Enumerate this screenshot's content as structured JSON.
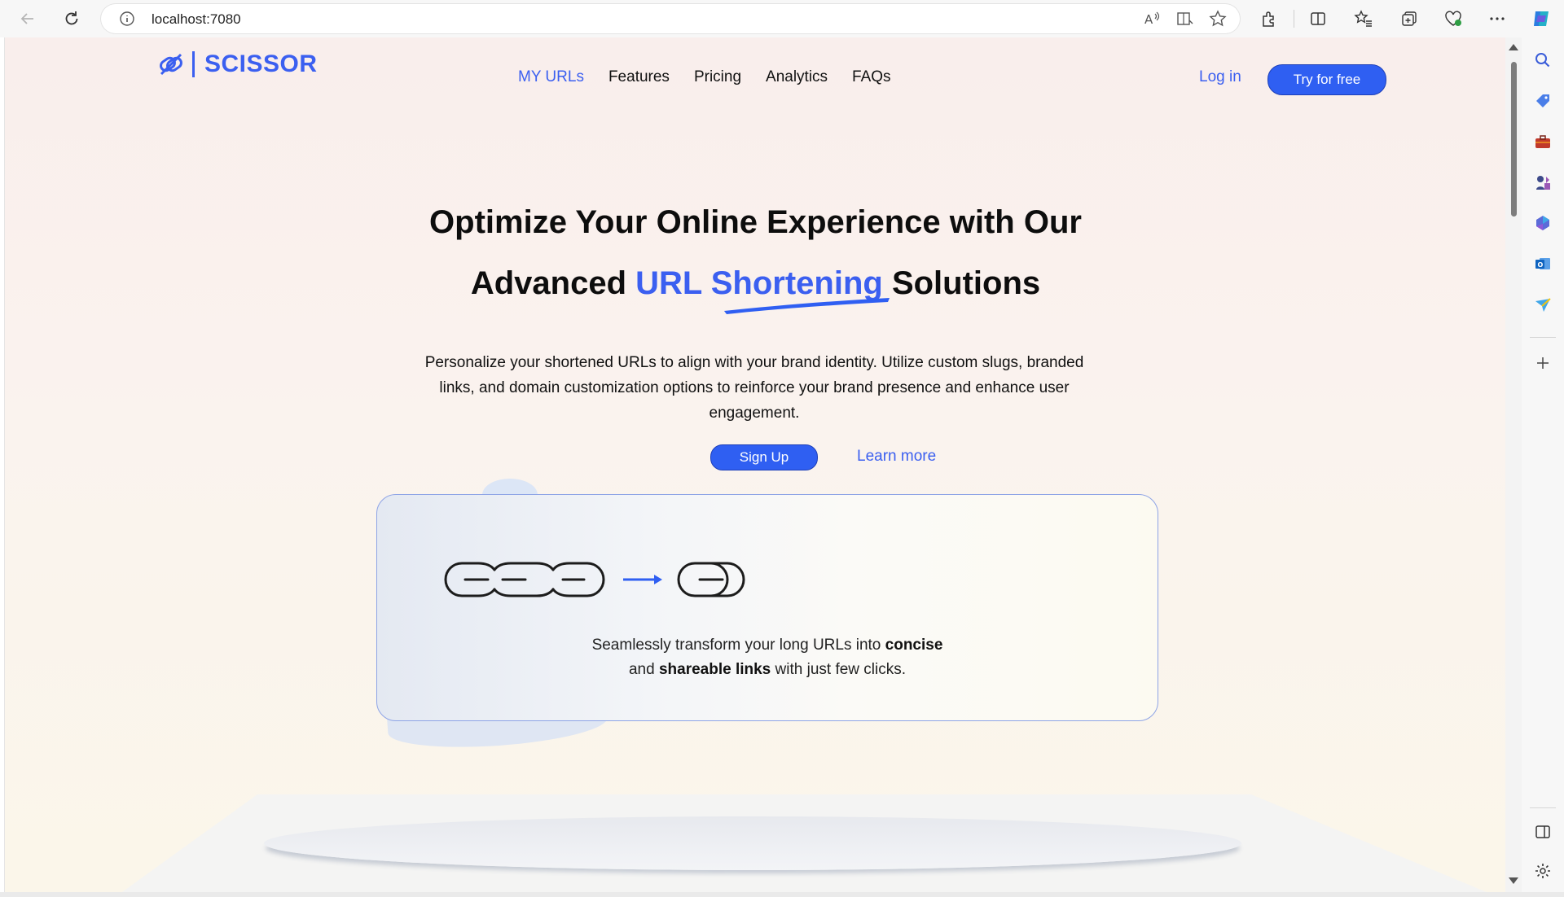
{
  "browser": {
    "address": "localhost:7080"
  },
  "site": {
    "logo": "SCISSOR",
    "nav": [
      "MY URLs",
      "Features",
      "Pricing",
      "Analytics",
      "FAQs"
    ],
    "login": "Log in",
    "try_free": "Try for free"
  },
  "hero": {
    "title_line1": "Optimize Your Online Experience with Our",
    "title_line2_pre": "Advanced ",
    "title_line2_accent": "URL Shortening",
    "title_line2_post": " Solutions",
    "description": "Personalize your shortened URLs to align with your brand identity. Utilize custom slugs, branded links, and domain customization options to reinforce your brand presence and enhance user engagement.",
    "signup": "Sign Up",
    "learn_more": "Learn more"
  },
  "card": {
    "text_1": "Seamlessly transform your long URLs into ",
    "text_bold_1": "concise",
    "text_2": "and ",
    "text_bold_2": "shareable links",
    "text_3": " with just few clicks."
  },
  "colors": {
    "accent": "#3b5ff0",
    "button": "#2f5ff2"
  }
}
